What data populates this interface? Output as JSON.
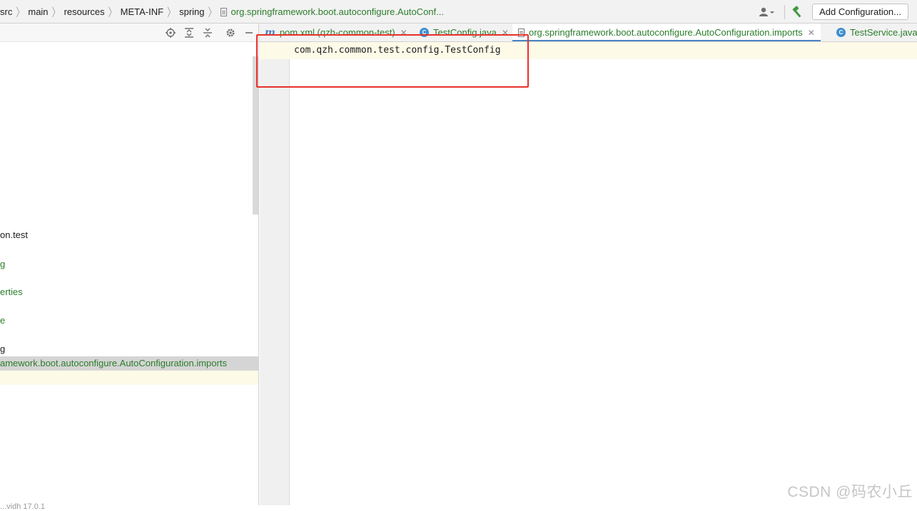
{
  "breadcrumb": [
    "src",
    "main",
    "resources",
    "META-INF",
    "spring",
    "org.springframework.boot.autoconfigure.AutoConf..."
  ],
  "toolbar": {
    "add_configuration": "Add Configuration...",
    "icons": [
      "user-icon",
      "hammer-icon"
    ]
  },
  "project_panel": {
    "toolbar_icons": [
      "locate-icon",
      "expand-all-icon",
      "collapse-all-icon",
      "gear-icon",
      "minimize-icon"
    ],
    "rows": [
      {
        "text": "on.test",
        "color": "#1e1e1e"
      },
      {
        "text": "g",
        "color": "#2b7d2b"
      },
      {
        "text": "erties",
        "color": "#2b7d2b"
      },
      {
        "text": "e",
        "color": "#2b7d2b"
      },
      {
        "text": "g",
        "color": "#1e1e1e"
      },
      {
        "text": "amework.boot.autoconfigure.AutoConfiguration.imports",
        "color": "#2b7d2b",
        "selected": true
      }
    ],
    "version_text": "...vidh 17.0.1"
  },
  "tabs": [
    {
      "label": "pom.xml (qzh-common-test)",
      "icon": "maven-icon"
    },
    {
      "label": "TestConfig.java",
      "icon": "class-icon"
    },
    {
      "label": "org.springframework.boot.autoconfigure.AutoConfiguration.imports",
      "icon": "file-icon",
      "active": true
    },
    {
      "label": "TestService.java",
      "icon": "class-icon"
    }
  ],
  "editor": {
    "lines": [
      "com.qzh.common.test.config.TestConfig"
    ]
  },
  "watermark": "CSDN @码农小丘",
  "colors": {
    "accent": "#4a83c4",
    "file_green": "#2b7d2b",
    "highlight_red": "#e8302a",
    "caret_line": "#fdfae8"
  }
}
